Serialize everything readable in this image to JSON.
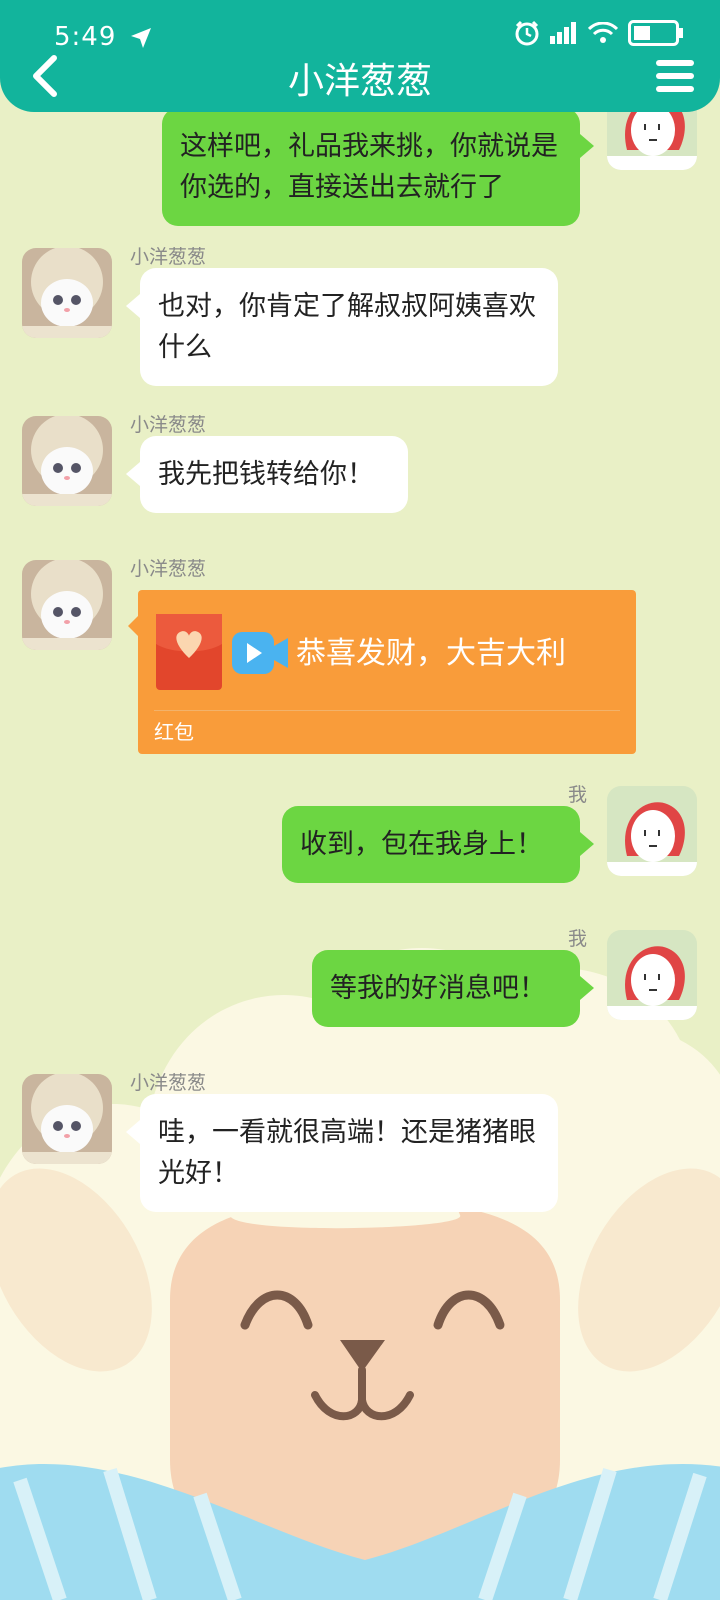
{
  "status_bar": {
    "time": "5:49"
  },
  "header": {
    "title": "小洋葱葱"
  },
  "messages": [
    {
      "text": "这样吧，礼品我来挑，你就说是你选的，直接送出去就行了"
    },
    {
      "sender": "小洋葱葱",
      "text": "也对，你肯定了解叔叔阿姨喜欢什么"
    },
    {
      "sender": "小洋葱葱",
      "text": "我先把钱转给你！"
    },
    {
      "sender": "小洋葱葱",
      "redpacket": {
        "title": "恭喜发财，大吉大利",
        "label": "红包"
      }
    },
    {
      "sender": "我",
      "text": "收到，包在我身上！"
    },
    {
      "sender": "我",
      "text": "等我的好消息吧！"
    },
    {
      "sender": "小洋葱葱",
      "text": "哇，一看就很高端！还是猪猪眼光好！"
    }
  ],
  "colors": {
    "header": "#12b49c",
    "bubble_self": "#6cd642",
    "bubble_other": "#ffffff",
    "redpacket": "#f99c3a",
    "background": "#e9f0c6"
  },
  "icons": [
    "back-arrow-icon",
    "menu-icon",
    "alarm-icon",
    "signal-icon",
    "wifi-icon",
    "battery-icon",
    "location-arrow-icon",
    "heart-envelope-icon",
    "video-icon"
  ]
}
